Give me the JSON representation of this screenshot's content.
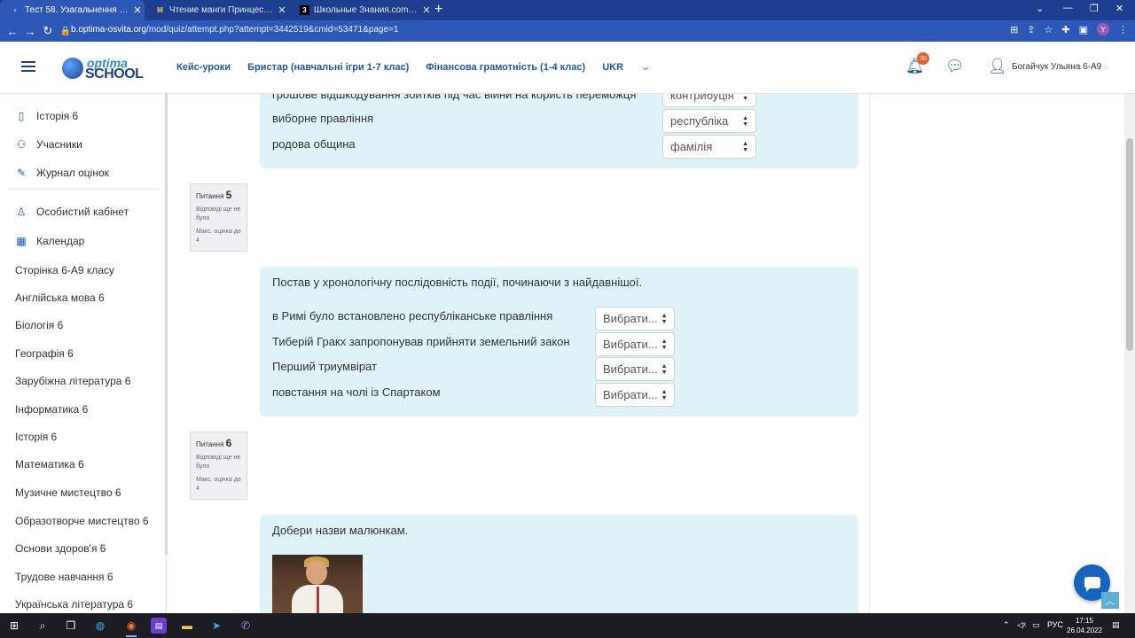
{
  "browser": {
    "tabs": [
      {
        "title": "Тест 58. Узагальнення з теми (за...",
        "favicon": "O",
        "active": true
      },
      {
        "title": "Чтение манги Принцесса с чер...",
        "favicon": "M",
        "active": false
      },
      {
        "title": "Школьные Знания.com - Решаю...",
        "favicon": "3",
        "active": false
      }
    ],
    "new_tab": "+",
    "url_host": "b.optima-osvita.org",
    "url_path": "/mod/quiz/attempt.php?attempt=3442519&cmid=53471&page=1",
    "profile_initial": "Y"
  },
  "header": {
    "logo_top": "optima",
    "logo_bottom": "SCHOOL",
    "nav": [
      "Кейс-уроки",
      "Бристар (навчальні ігри 1-7 клас)",
      "Фінансова грамотність (1-4 клас)",
      "UKR"
    ],
    "notifications_count": "30",
    "user_name": "Богайчук Ульяна 6-А9"
  },
  "sidebar": {
    "top_items": [
      {
        "label": "Історія 6",
        "icon": "book-icon"
      },
      {
        "label": "Учасники",
        "icon": "users-icon"
      },
      {
        "label": "Журнал оцінок",
        "icon": "gradebook-icon"
      }
    ],
    "mid_items": [
      {
        "label": "Особистий кабінет",
        "icon": "user-icon"
      },
      {
        "label": "Календар",
        "icon": "calendar-icon"
      }
    ],
    "courses": [
      "Сторінка 6-А9 класу",
      "Англійська мова 6",
      "Біологія 6",
      "Географія 6",
      "Зарубіжна література 6",
      "Інформатика 6",
      "Історія 6",
      "Математика 6",
      "Музичне мистецтво 6",
      "Образотворче мистецтво 6",
      "Основи здоров'я 6",
      "Трудове навчання 6",
      "Українська література 6"
    ]
  },
  "q4": {
    "rows": [
      {
        "text": "грошове відшкодування збитків під час війни на користь переможця",
        "selected": "контрибуція"
      },
      {
        "text": "виборне правління",
        "selected": "республіка"
      },
      {
        "text": "родова община",
        "selected": "фамілія"
      }
    ]
  },
  "q5": {
    "label": "Питання",
    "number": "5",
    "status": "Відповіді ще не було",
    "max": "Макс. оцінка до 4",
    "prompt": "Постав у хронологічну послідовність події, починаючи з найдавнішої.",
    "rows": [
      {
        "text": "в Римі було встановлено республіканське правління",
        "selected": "Вибрати..."
      },
      {
        "text": "Тиберій Гракх  запропонував прийняти земельний закон",
        "selected": "Вибрати..."
      },
      {
        "text": "Перший триумвірат",
        "selected": "Вибрати..."
      },
      {
        "text": "повстання на чолі із Спартаком",
        "selected": "Вибрати..."
      }
    ]
  },
  "q6": {
    "label": "Питання",
    "number": "6",
    "status": "Відповіді ще не було",
    "max": "Макс. оцінка до 4",
    "prompt": "Добери назви малюнкам."
  },
  "taskbar": {
    "lang": "РУС",
    "time": "17:15",
    "date": "26.04.2022"
  },
  "colors": {
    "brand_dark": "#1e3f8f",
    "brand_blue": "#1e5aa8",
    "question_bg": "#def2f8",
    "badge": "#f05b2b"
  }
}
